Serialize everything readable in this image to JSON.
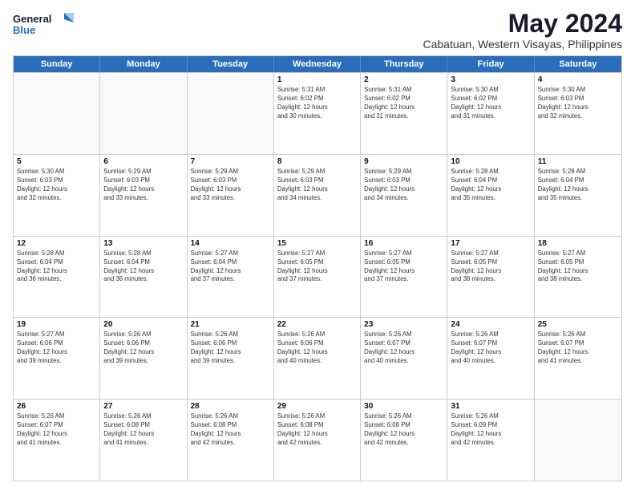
{
  "logo": {
    "line1": "General",
    "line2": "Blue"
  },
  "title": "May 2024",
  "subtitle": "Cabatuan, Western Visayas, Philippines",
  "days": [
    "Sunday",
    "Monday",
    "Tuesday",
    "Wednesday",
    "Thursday",
    "Friday",
    "Saturday"
  ],
  "rows": [
    [
      {
        "day": "",
        "info": ""
      },
      {
        "day": "",
        "info": ""
      },
      {
        "day": "",
        "info": ""
      },
      {
        "day": "1",
        "info": "Sunrise: 5:31 AM\nSunset: 6:02 PM\nDaylight: 12 hours\nand 30 minutes."
      },
      {
        "day": "2",
        "info": "Sunrise: 5:31 AM\nSunset: 6:02 PM\nDaylight: 12 hours\nand 31 minutes."
      },
      {
        "day": "3",
        "info": "Sunrise: 5:30 AM\nSunset: 6:02 PM\nDaylight: 12 hours\nand 31 minutes."
      },
      {
        "day": "4",
        "info": "Sunrise: 5:30 AM\nSunset: 6:03 PM\nDaylight: 12 hours\nand 32 minutes."
      }
    ],
    [
      {
        "day": "5",
        "info": "Sunrise: 5:30 AM\nSunset: 6:03 PM\nDaylight: 12 hours\nand 32 minutes."
      },
      {
        "day": "6",
        "info": "Sunrise: 5:29 AM\nSunset: 6:03 PM\nDaylight: 12 hours\nand 33 minutes."
      },
      {
        "day": "7",
        "info": "Sunrise: 5:29 AM\nSunset: 6:03 PM\nDaylight: 12 hours\nand 33 minutes."
      },
      {
        "day": "8",
        "info": "Sunrise: 5:29 AM\nSunset: 6:03 PM\nDaylight: 12 hours\nand 34 minutes."
      },
      {
        "day": "9",
        "info": "Sunrise: 5:29 AM\nSunset: 6:03 PM\nDaylight: 12 hours\nand 34 minutes."
      },
      {
        "day": "10",
        "info": "Sunrise: 5:28 AM\nSunset: 6:04 PM\nDaylight: 12 hours\nand 35 minutes."
      },
      {
        "day": "11",
        "info": "Sunrise: 5:28 AM\nSunset: 6:04 PM\nDaylight: 12 hours\nand 35 minutes."
      }
    ],
    [
      {
        "day": "12",
        "info": "Sunrise: 5:28 AM\nSunset: 6:04 PM\nDaylight: 12 hours\nand 36 minutes."
      },
      {
        "day": "13",
        "info": "Sunrise: 5:28 AM\nSunset: 6:04 PM\nDaylight: 12 hours\nand 36 minutes."
      },
      {
        "day": "14",
        "info": "Sunrise: 5:27 AM\nSunset: 6:04 PM\nDaylight: 12 hours\nand 37 minutes."
      },
      {
        "day": "15",
        "info": "Sunrise: 5:27 AM\nSunset: 6:05 PM\nDaylight: 12 hours\nand 37 minutes."
      },
      {
        "day": "16",
        "info": "Sunrise: 5:27 AM\nSunset: 6:05 PM\nDaylight: 12 hours\nand 37 minutes."
      },
      {
        "day": "17",
        "info": "Sunrise: 5:27 AM\nSunset: 6:05 PM\nDaylight: 12 hours\nand 38 minutes."
      },
      {
        "day": "18",
        "info": "Sunrise: 5:27 AM\nSunset: 6:05 PM\nDaylight: 12 hours\nand 38 minutes."
      }
    ],
    [
      {
        "day": "19",
        "info": "Sunrise: 5:27 AM\nSunset: 6:06 PM\nDaylight: 12 hours\nand 39 minutes."
      },
      {
        "day": "20",
        "info": "Sunrise: 5:26 AM\nSunset: 6:06 PM\nDaylight: 12 hours\nand 39 minutes."
      },
      {
        "day": "21",
        "info": "Sunrise: 5:26 AM\nSunset: 6:06 PM\nDaylight: 12 hours\nand 39 minutes."
      },
      {
        "day": "22",
        "info": "Sunrise: 5:26 AM\nSunset: 6:06 PM\nDaylight: 12 hours\nand 40 minutes."
      },
      {
        "day": "23",
        "info": "Sunrise: 5:26 AM\nSunset: 6:07 PM\nDaylight: 12 hours\nand 40 minutes."
      },
      {
        "day": "24",
        "info": "Sunrise: 5:26 AM\nSunset: 6:07 PM\nDaylight: 12 hours\nand 40 minutes."
      },
      {
        "day": "25",
        "info": "Sunrise: 5:26 AM\nSunset: 6:07 PM\nDaylight: 12 hours\nand 41 minutes."
      }
    ],
    [
      {
        "day": "26",
        "info": "Sunrise: 5:26 AM\nSunset: 6:07 PM\nDaylight: 12 hours\nand 41 minutes."
      },
      {
        "day": "27",
        "info": "Sunrise: 5:26 AM\nSunset: 6:08 PM\nDaylight: 12 hours\nand 41 minutes."
      },
      {
        "day": "28",
        "info": "Sunrise: 5:26 AM\nSunset: 6:08 PM\nDaylight: 12 hours\nand 42 minutes."
      },
      {
        "day": "29",
        "info": "Sunrise: 5:26 AM\nSunset: 6:08 PM\nDaylight: 12 hours\nand 42 minutes."
      },
      {
        "day": "30",
        "info": "Sunrise: 5:26 AM\nSunset: 6:08 PM\nDaylight: 12 hours\nand 42 minutes."
      },
      {
        "day": "31",
        "info": "Sunrise: 5:26 AM\nSunset: 6:09 PM\nDaylight: 12 hours\nand 42 minutes."
      },
      {
        "day": "",
        "info": ""
      }
    ]
  ]
}
